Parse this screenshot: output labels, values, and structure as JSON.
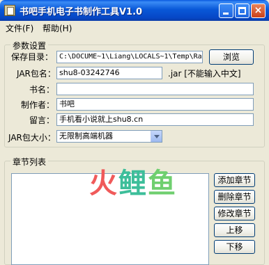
{
  "window": {
    "title": "书吧手机电子书制作工具V1.0",
    "min_label": "",
    "max_label": "",
    "close_label": "×"
  },
  "menu": {
    "file": "文件(F)",
    "help": "帮助(H)"
  },
  "params": {
    "legend": "参数设置",
    "save_dir_label": "保存目录：",
    "save_dir_value": "C:\\DOCUME~1\\Liang\\LOCALS~1\\Temp\\Ra",
    "browse_label": "浏览",
    "jar_name_label": "JAR包名：",
    "jar_name_value": "shu8-03242746",
    "jar_suffix_note": ".jar [不能输入中文]",
    "book_name_label": "书名：",
    "book_name_value": "",
    "author_label": "制作者：",
    "author_value": "书吧",
    "message_label": "留言：",
    "message_value": "手机看小说就上shu8.cn",
    "jar_size_label": "JAR包大小：",
    "jar_size_value": "无限制高端机器"
  },
  "chapters": {
    "legend": "章节列表",
    "add_label": "添加章节",
    "delete_label": "删除章节",
    "edit_label": "修改章节",
    "up_label": "上移",
    "down_label": "下移",
    "items": []
  },
  "watermark": {
    "part1": "火",
    "part2": "鲤",
    "part3": "鱼"
  }
}
